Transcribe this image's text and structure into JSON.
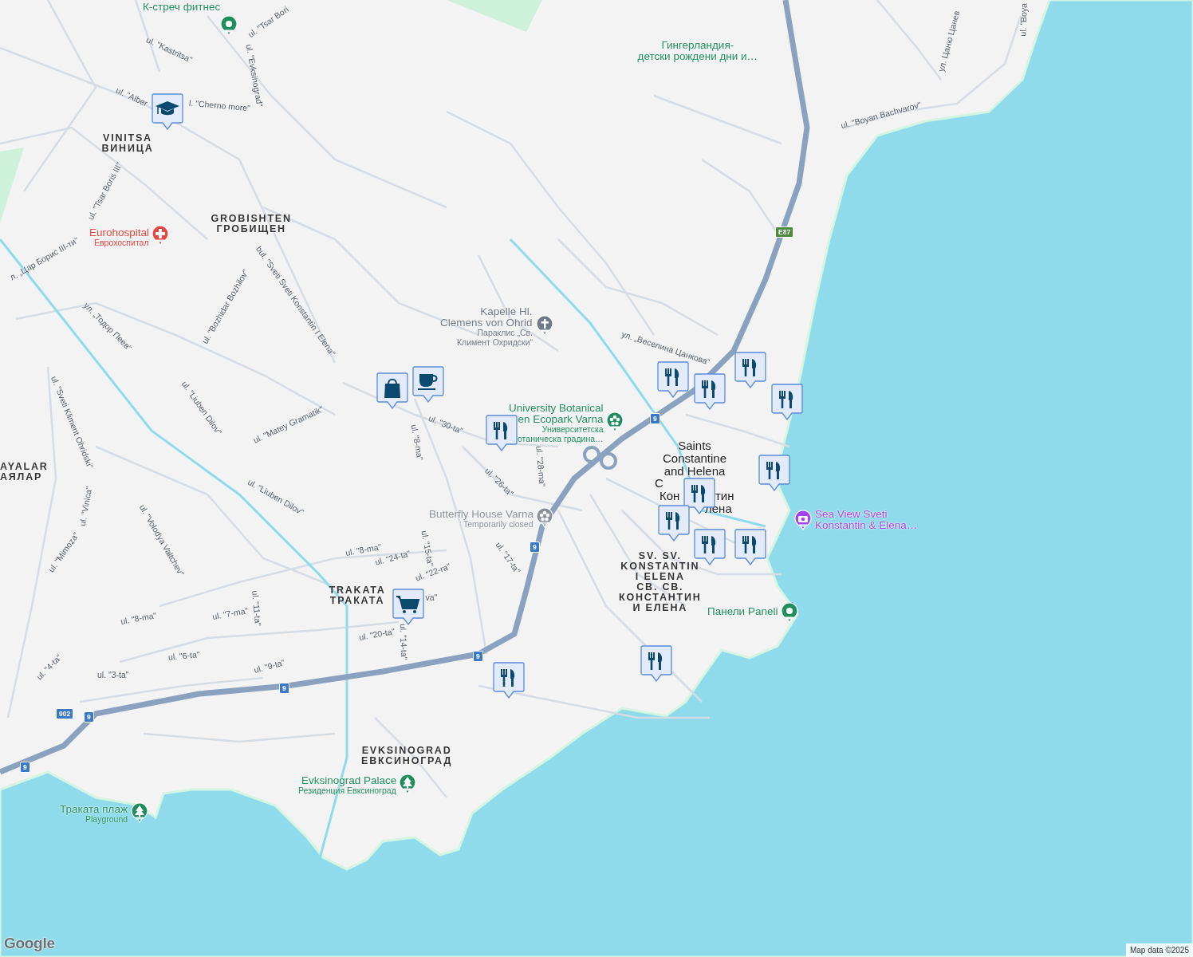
{
  "map": {
    "area_labels": [
      {
        "lines": [
          "VINITSA",
          "ВИНИЦА"
        ]
      },
      {
        "lines": [
          "GROBISHTEN",
          "ГРОБИЩЕН"
        ]
      },
      {
        "lines": [
          "AYALAR",
          "АЯЛАР"
        ]
      },
      {
        "lines": [
          "TRAKATA",
          "ТРАКАТА"
        ]
      },
      {
        "lines": [
          "SV. SV.",
          "KONSTANTIN",
          "I ELENA",
          "СВ. СВ.",
          "КОНСТАНТИН",
          "И ЕЛЕНА"
        ]
      },
      {
        "lines": [
          "EVKSINOGRAD",
          "ЕВКСИНОГРАД"
        ]
      }
    ],
    "city_label": {
      "name": "Saints\nConstantine\nand Helena",
      "fragments": [
        "С",
        "Кон",
        "тин",
        "лена"
      ]
    },
    "places": [
      {
        "kind": "fitness",
        "name": "К-стреч фитнес",
        "color": "#1e8e5e"
      },
      {
        "kind": "text",
        "name": "Гингерландия-\nдетски рождени дни и…",
        "color": "#1e8e5e"
      },
      {
        "kind": "hospital",
        "name": "Eurohospital",
        "subtitle": "Еврохоспитал",
        "color": "#e8453c"
      },
      {
        "kind": "church",
        "name": "Kapelle Hl.\nClemens von Ohrid",
        "subtitle": "Параклис „Св.\nКлимент Охридски“",
        "color": "#707a86"
      },
      {
        "kind": "garden",
        "name": "University Botanical\nen Ecopark Varna",
        "subtitle": "Университетска\nотаническа градина…",
        "color": "#1e8e5e"
      },
      {
        "kind": "garden",
        "name": "Butterfly House Varna",
        "subtitle": "Temporarily closed",
        "color": "#8a9099"
      },
      {
        "kind": "camera",
        "name": "Sea View Sveti\nKonstantin & Elena…",
        "color": "#a142f4"
      },
      {
        "kind": "fitness",
        "name": "Панели Paneli",
        "color": "#1e8e5e"
      },
      {
        "kind": "tree",
        "name": "Evksinograd Palace",
        "subtitle": "Резиденция Евксиноград",
        "color": "#1e8e5e"
      },
      {
        "kind": "tree",
        "name": "Траката плаж",
        "subtitle": "Playground",
        "color": "#1e8e5e"
      }
    ],
    "streets": [
      "ul. \"Tsar Bori",
      "ul. \"Kastritsa\"",
      "ul. \"Evksinograd\"",
      "ul. \"Alber",
      "l. \"Cherno more\"",
      "ul. \"Tsar Boris III\"",
      "л. „Цар Борис III-ти“",
      "bul. \"Sveti Sveti Konstantin I Elena\"",
      "ul. \"Bozhidar Bozhilov\"",
      "ул. „Тодор Пеев“",
      "ul. \"Liuben Dilov\"",
      "ul. \"Matey Gramatik\"",
      "ul. \"Sveti Kliment Ohridski\"",
      "ul. \"Vinica\"",
      "ul. \"Mimoza\"",
      "ul. \"Volodya Valtchev\"",
      "ul. \"Liuben Dilov\"",
      "ul. \"8-ma\"",
      "ul. \"30-ta\"",
      "ul. \"26-ta\"",
      "ul. \"28-ma\"",
      "ul. \"8-ma\"",
      "ul. \"24-ta\"",
      "ul. \"15-ta\"",
      "ul. \"22-ra\"",
      "va\"",
      "ul. \"17-ta\"",
      "ul. \"8-ma\"",
      "ul. \"7-ma\"",
      "ul. \"11-ta\"",
      "ul. \"6-ta\"",
      "ul. \"9-ta\"",
      "ul. \"4-ta\"",
      "ul. \"3-ta\"",
      "ul. \"20-ta\"",
      "ul. \"14-ta\"",
      "ул. „Веселина Цанкова“",
      "ul. \"Boyan Bachvarov\"",
      "ul. \"Boya",
      "ул. Цаню Цанев"
    ],
    "markers": [
      {
        "kind": "school"
      },
      {
        "kind": "cafe"
      },
      {
        "kind": "restaurant"
      },
      {
        "kind": "restaurant"
      },
      {
        "kind": "shop"
      },
      {
        "kind": "restaurant"
      },
      {
        "kind": "restaurant"
      },
      {
        "kind": "restaurant"
      },
      {
        "kind": "restaurant"
      },
      {
        "kind": "restaurant"
      },
      {
        "kind": "restaurant"
      },
      {
        "kind": "restaurant"
      },
      {
        "kind": "restaurant"
      },
      {
        "kind": "grocery"
      },
      {
        "kind": "restaurant"
      },
      {
        "kind": "restaurant"
      }
    ],
    "shields": [
      {
        "kind": "european",
        "label": "E87"
      },
      {
        "kind": "national",
        "label": "9"
      },
      {
        "kind": "national",
        "label": "9"
      },
      {
        "kind": "national",
        "label": "9"
      },
      {
        "kind": "national",
        "label": "9"
      },
      {
        "kind": "national",
        "label": "902"
      },
      {
        "kind": "national",
        "label": "9"
      },
      {
        "kind": "national",
        "label": "9"
      }
    ],
    "logo": "Google",
    "attribution": "Map data ©2025"
  }
}
